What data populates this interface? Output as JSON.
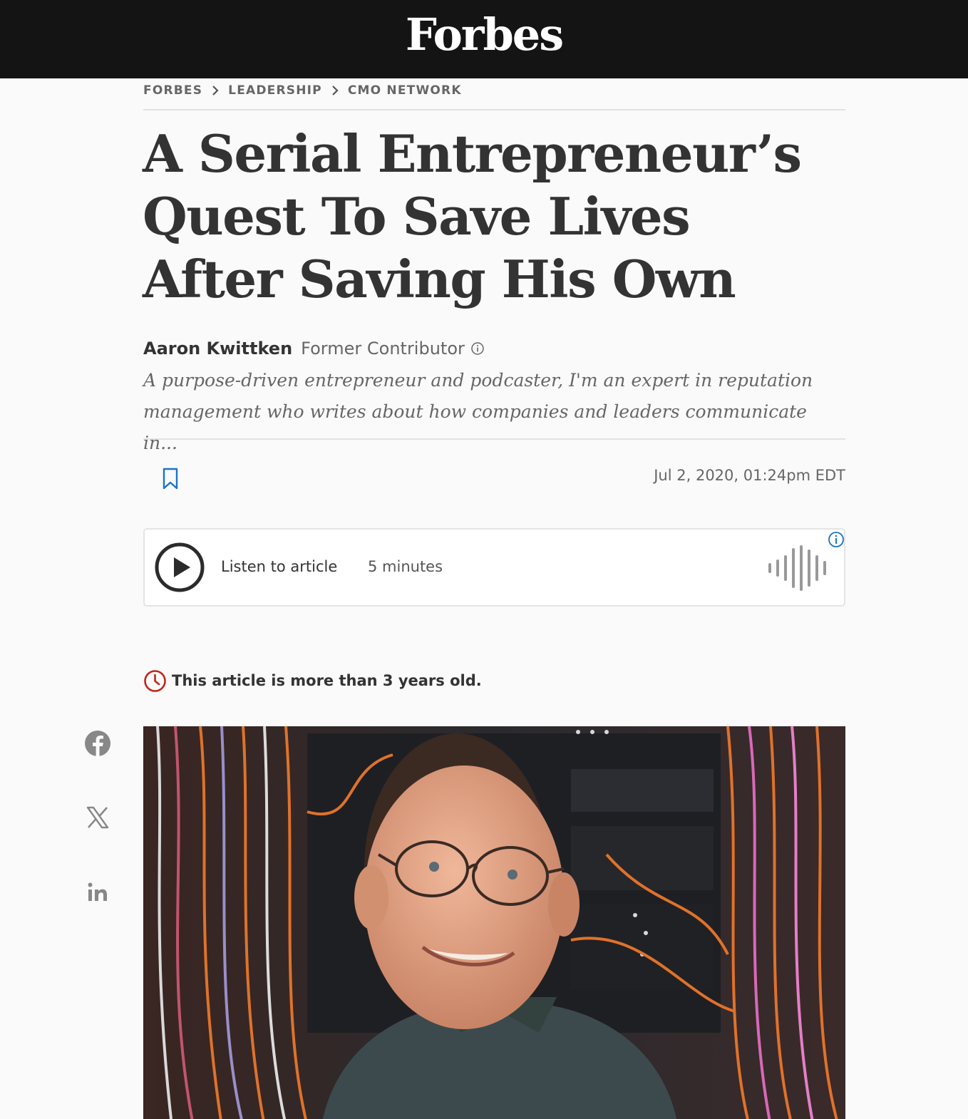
{
  "header": {
    "logo": "Forbes"
  },
  "breadcrumb": {
    "items": [
      "FORBES",
      "LEADERSHIP",
      "CMO NETWORK"
    ]
  },
  "article": {
    "headline": "A Serial Entrepreneur’s Quest To Save Lives After Saving His Own",
    "author": "Aaron Kwittken",
    "author_role": "Former Contributor",
    "bio": "A purpose-driven entrepreneur and podcaster, I'm an expert in reputation management who writes about how companies and leaders communicate in...",
    "date": "Jul 2, 2020, 01:24pm EDT",
    "age_notice": "This article is more than 3 years old."
  },
  "audio_player": {
    "label": "Listen to article",
    "duration": "5 minutes"
  },
  "share": {
    "icons": [
      "facebook-icon",
      "x-icon",
      "linkedin-icon"
    ]
  },
  "colors": {
    "topbar": "#141414",
    "accent_blue": "#1a73c7",
    "alert_red": "#c0271c"
  }
}
